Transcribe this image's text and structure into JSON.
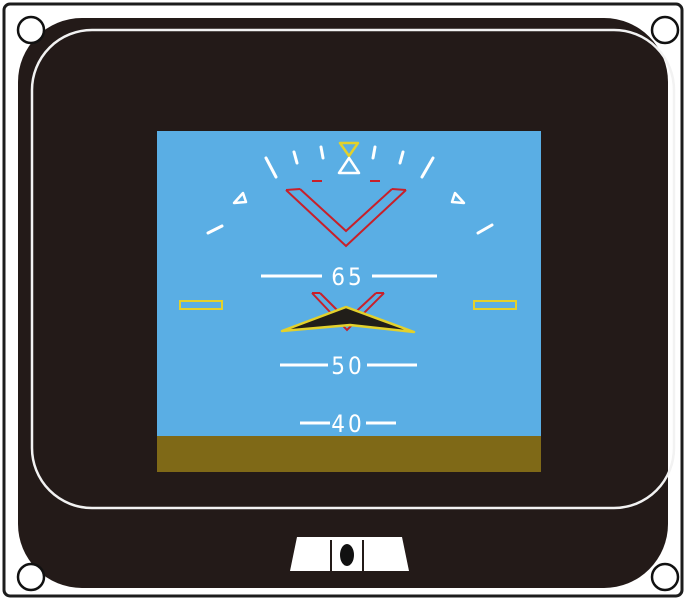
{
  "instrument": {
    "type": "attitude-director-indicator",
    "colors": {
      "sky": "#5aaee4",
      "ground": "#7f6917",
      "bezel": "#231a18",
      "marking": "#ffffff",
      "chevron": "#c8202a",
      "reference": "#e3d12b",
      "aircraft_symbol": "#211e19"
    },
    "pitch_ladder": [
      {
        "label": "65"
      },
      {
        "label": "50"
      },
      {
        "label": "40"
      }
    ],
    "icons": [
      "mounting-screw-icon",
      "bank-pointer-icon",
      "aircraft-symbol-icon",
      "chevron-icon",
      "knob-icon"
    ]
  }
}
